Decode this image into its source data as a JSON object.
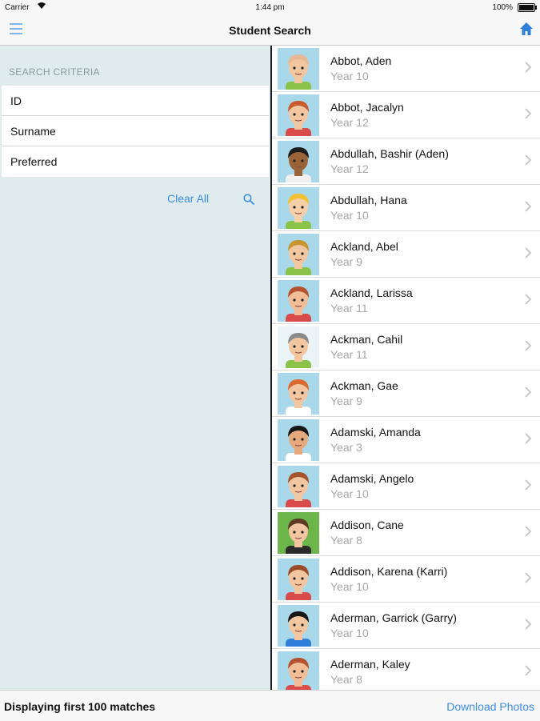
{
  "status_bar": {
    "carrier": "Carrier",
    "time": "1:44 pm",
    "battery": "100%"
  },
  "nav": {
    "title": "Student Search"
  },
  "search": {
    "section_header": "SEARCH CRITERIA",
    "fields": [
      {
        "placeholder": "ID",
        "value": ""
      },
      {
        "placeholder": "Surname",
        "value": ""
      },
      {
        "placeholder": "Preferred",
        "value": ""
      }
    ],
    "clear_label": "Clear All"
  },
  "students": [
    {
      "name": "Abbot, Aden",
      "year": "Year 10",
      "bg": "#a9d8ea",
      "skin": "#f2c6a0",
      "hair": "#e8b894",
      "shirt": "#8bc34a"
    },
    {
      "name": "Abbot, Jacalyn",
      "year": "Year 12",
      "bg": "#a9d8ea",
      "skin": "#f2c6a0",
      "hair": "#c85a2e",
      "shirt": "#d84b4b"
    },
    {
      "name": "Abdullah, Bashir (Aden)",
      "year": "Year 12",
      "bg": "#a9d8ea",
      "skin": "#9a6438",
      "hair": "#1c1c1c",
      "shirt": "#f0f0f0"
    },
    {
      "name": "Abdullah, Hana",
      "year": "Year 10",
      "bg": "#a9d8ea",
      "skin": "#f4cfa8",
      "hair": "#f2c232",
      "shirt": "#8bc34a"
    },
    {
      "name": "Ackland, Abel",
      "year": "Year 9",
      "bg": "#a9d8ea",
      "skin": "#f2c6a0",
      "hair": "#c8952c",
      "shirt": "#8bc34a"
    },
    {
      "name": "Ackland, Larissa",
      "year": "Year 11",
      "bg": "#a9d8ea",
      "skin": "#f0bd96",
      "hair": "#b5532e",
      "shirt": "#d84b4b"
    },
    {
      "name": "Ackman, Cahil",
      "year": "Year 11",
      "bg": "#eaf3f5",
      "skin": "#f2c6a0",
      "hair": "#8a8a8a",
      "shirt": "#8bc34a"
    },
    {
      "name": "Ackman, Gae",
      "year": "Year 9",
      "bg": "#a9d8ea",
      "skin": "#f2c6a0",
      "hair": "#d9692e",
      "shirt": "#ffffff"
    },
    {
      "name": "Adamski, Amanda",
      "year": "Year 3",
      "bg": "#a9d8ea",
      "skin": "#e6a97e",
      "hair": "#151515",
      "shirt": "#ffffff"
    },
    {
      "name": "Adamski, Angelo",
      "year": "Year 10",
      "bg": "#a9d8ea",
      "skin": "#f2c6a0",
      "hair": "#a5532a",
      "shirt": "#d84b4b"
    },
    {
      "name": "Addison, Cane",
      "year": "Year 8",
      "bg": "#6bb54a",
      "skin": "#f2c6a0",
      "hair": "#5a3a22",
      "shirt": "#2a2a2a"
    },
    {
      "name": "Addison, Karena (Karri)",
      "year": "Year 10",
      "bg": "#a9d8ea",
      "skin": "#f2c6a0",
      "hair": "#9a4a26",
      "shirt": "#d84b4b"
    },
    {
      "name": "Aderman, Garrick (Garry)",
      "year": "Year 10",
      "bg": "#a9d8ea",
      "skin": "#f2c6a0",
      "hair": "#151515",
      "shirt": "#2f7fd8"
    },
    {
      "name": "Aderman, Kaley",
      "year": "Year 8",
      "bg": "#a9d8ea",
      "skin": "#f0bd96",
      "hair": "#b5532e",
      "shirt": "#d84b4b"
    }
  ],
  "footer": {
    "matches_text": "Displaying first 100 matches",
    "download_label": "Download Photos"
  },
  "colors": {
    "accent": "#3a8ee6",
    "panel": "#dfebec",
    "secondary_text": "#a6a6a6"
  },
  "icons": {
    "menu": "menu-icon",
    "home": "home-icon",
    "search": "search-icon",
    "chevron": "chevron-right-icon"
  }
}
